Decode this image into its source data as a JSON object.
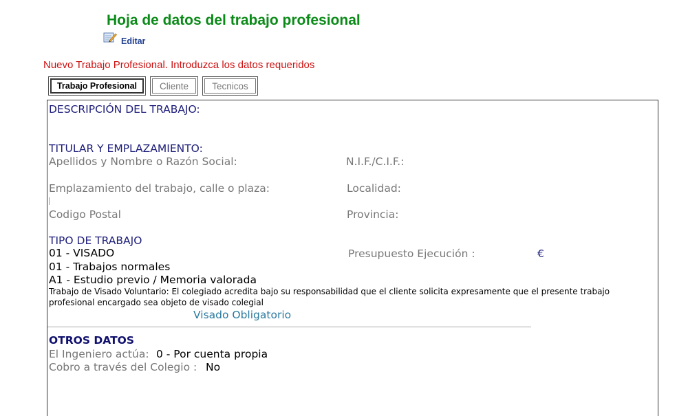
{
  "header": {
    "title": "Hoja de datos del trabajo profesional",
    "edit_label": "Editar"
  },
  "status_message": "Nuevo Trabajo Profesional. Introduzca los datos requeridos",
  "tabs": [
    {
      "label": "Trabajo Profesional",
      "active": true
    },
    {
      "label": "Cliente",
      "active": false
    },
    {
      "label": "Tecnicos",
      "active": false
    }
  ],
  "form": {
    "descripcion_heading": "DESCRIPCIÓN DEL TRABAJO:",
    "titular_heading": "TITULAR Y EMPLAZAMIENTO:",
    "apellidos_label": "Apellidos y Nombre o Razón Social:",
    "nif_label": "N.I.F./C.I.F.:",
    "emplazamiento_label": "Emplazamiento del trabajo, calle o plaza:",
    "localidad_label": "Localidad:",
    "codigo_postal_label": "Codigo Postal",
    "provincia_label": "Provincia:",
    "tipo_heading": "TIPO DE TRABAJO",
    "tipo_visado": "01 - VISADO",
    "presupuesto_label": "Presupuesto Ejecución :",
    "currency": "€",
    "tipo_trabajos": "01 - Trabajos normales",
    "tipo_estudio": "A1 - Estudio previo / Memoria valorada",
    "visado_note": "Trabajo de Visado Voluntario: El colegiado acredita bajo su responsabilidad que el cliente solicita expresamente que el presente trabajo profesional encargado sea objeto de visado colegial",
    "visado_link": "Visado Obligatorio",
    "otros_heading": "OTROS DATOS",
    "ingeniero_label": "El Ingeniero actúa:",
    "ingeniero_value": "0 - Por cuenta propia",
    "cobro_label": "Cobro a través del Colegio :",
    "cobro_value": "No"
  },
  "colors": {
    "title": "#0a8a17",
    "status": "#cc1010",
    "heading": "#1d1d7a",
    "label": "#777777",
    "link": "#2a7a9f"
  }
}
